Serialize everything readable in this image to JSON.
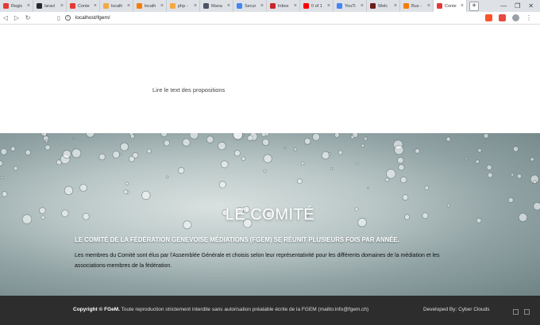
{
  "tabs": [
    {
      "label": "Regis",
      "color": "#e53935"
    },
    {
      "label": "laravi",
      "color": "#24292e"
    },
    {
      "label": "Conte",
      "color": "#e53935"
    },
    {
      "label": "localh",
      "color": "#f4a942"
    },
    {
      "label": "localh",
      "color": "#f57c00"
    },
    {
      "label": "php -",
      "color": "#f4a942"
    },
    {
      "label": "Mana",
      "color": "#4b5563"
    },
    {
      "label": "Secur",
      "color": "#4285f4"
    },
    {
      "label": "Inbox",
      "color": "#c62828"
    },
    {
      "label": "0 of 1",
      "color": "#ff0000"
    },
    {
      "label": "YouTi",
      "color": "#4285f4"
    },
    {
      "label": "Welc",
      "color": "#6b1d1d"
    },
    {
      "label": "Bus -",
      "color": "#f57c00"
    },
    {
      "label": "Conte",
      "color": "#e53935"
    }
  ],
  "active_tab_index": 13,
  "browser": {
    "url": "localhost/fgem/"
  },
  "page": {
    "link_text": "Lire le text des propositions",
    "hero_title": "LE COMITÉ",
    "hero_subtitle": "LE COMITÉ DE LA FÉDÉRATION GENEVOISE MÉDIATIONS (FGEM) SE RÉUNIT PLUSIEURS FOIS PAR ANNÉE.",
    "hero_body": "Les membres du Comité sont élus par l'Assemblée Générale et choisis selon leur représentativité pour les différents domaines de la médiation et les associations-membres de la fédération."
  },
  "footer": {
    "copyright_label": "Copyright © FGeM.",
    "copyright_text": " Toute reproduction strictement interdite sans autorisation préalable écrite de la FGEM (mailto:info@fgem.ch)",
    "developed_by": "Developed By: Cyber Clouds"
  },
  "icons": {
    "tab_close": "×",
    "new_tab": "+",
    "back": "◁",
    "forward": "▷",
    "reload": "↻",
    "bookmark": "▯",
    "menu": "⋮"
  }
}
